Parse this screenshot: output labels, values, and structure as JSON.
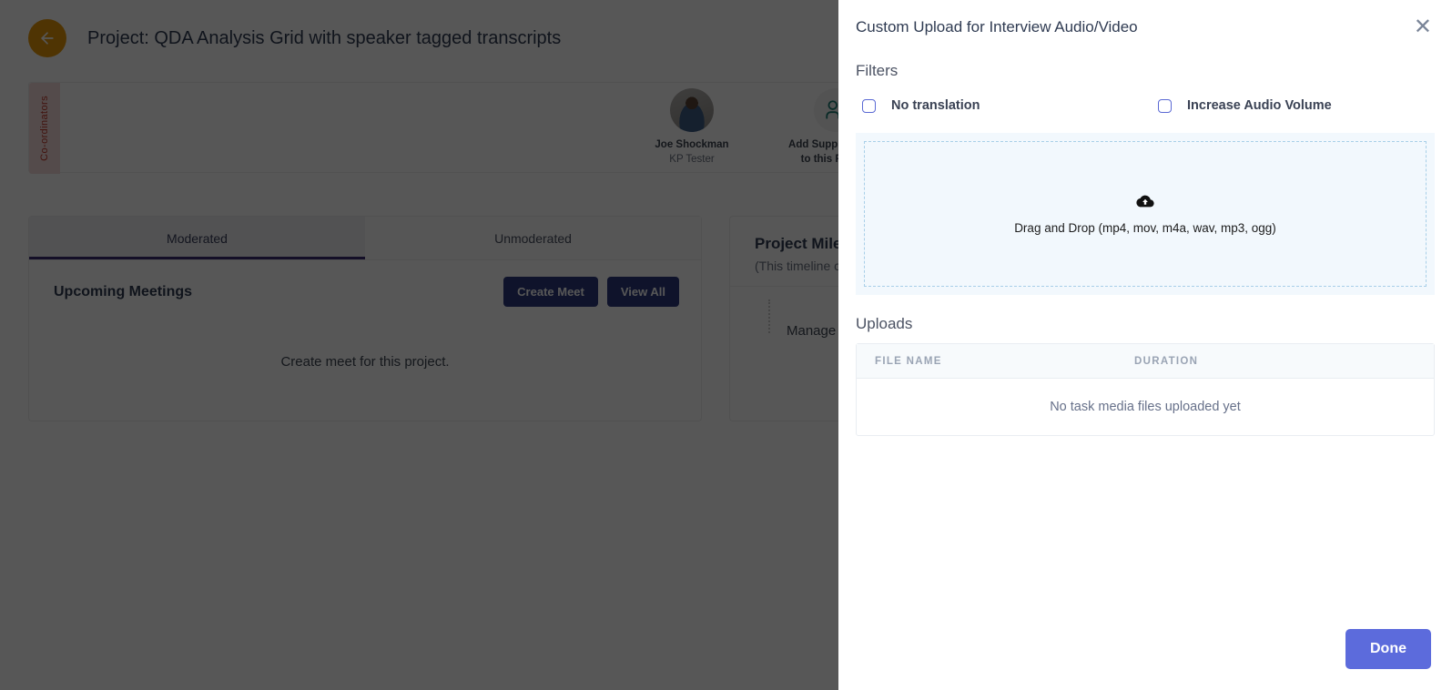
{
  "background": {
    "back_button_icon": "arrow-left-icon",
    "project_title": "Project: QDA Analysis Grid with speaker tagged transcripts",
    "coordinators_label": "Co-ordinators",
    "people": [
      {
        "avatar": "user-photo-avatar",
        "name": "Joe Shockman",
        "role": "KP Tester"
      },
      {
        "avatar": "add-user-icon",
        "line1": "Add Supplier/Team",
        "line2": "to this Project"
      }
    ],
    "tabs": [
      {
        "label": "Moderated",
        "active": true
      },
      {
        "label": "Unmoderated",
        "active": false
      }
    ],
    "meetings": {
      "title": "Upcoming Meetings",
      "create_label": "Create Meet",
      "view_all_label": "View All",
      "empty_text": "Create meet for this project."
    },
    "milestones": {
      "title": "Project Milestones",
      "subtitle": "(This timeline covers)",
      "item": "Manage share"
    }
  },
  "panel": {
    "title": "Custom Upload for Interview Audio/Video",
    "close_icon": "close-icon",
    "filters": {
      "heading": "Filters",
      "options": [
        {
          "label": "No translation",
          "checked": false
        },
        {
          "label": "Increase Audio Volume",
          "checked": false
        }
      ]
    },
    "dropzone": {
      "icon": "cloud-upload-icon",
      "text": "Drag and Drop (mp4, mov, m4a, wav, mp3, ogg)"
    },
    "uploads": {
      "heading": "Uploads",
      "columns": [
        "FILE NAME",
        "DURATION"
      ],
      "rows": [],
      "empty_text": "No task media files uploaded yet"
    },
    "footer": {
      "done_label": "Done"
    }
  },
  "colors": {
    "accent_done": "#5c6bdc",
    "back_button": "#e8990b",
    "tab_active_underline": "#3b2c73",
    "primary_button": "#2e3a7e",
    "checkbox_border": "#5b6ad4",
    "dropzone_bg": "#f2f8fd",
    "dropzone_border": "#a8cfe8",
    "coordinator_tab": "#f6dbdb",
    "coordinator_text": "#c0392b"
  }
}
